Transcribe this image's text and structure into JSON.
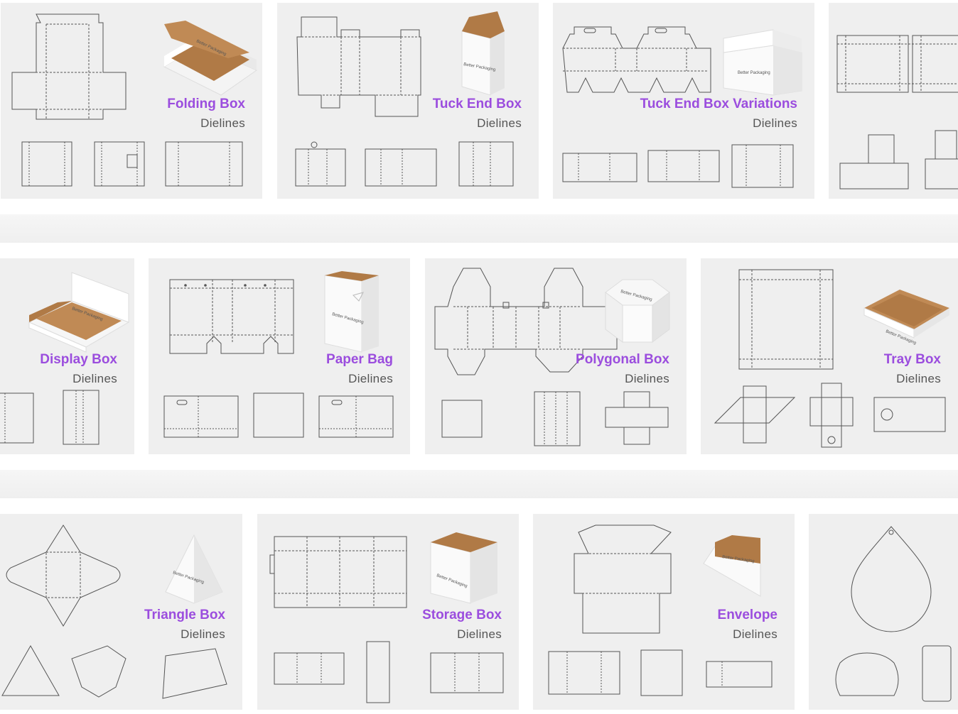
{
  "rows": [
    {
      "cards": [
        {
          "title": "Folding Box",
          "subtitle": "Dielines",
          "brand": "Better Packaging"
        },
        {
          "title": "Tuck End Box",
          "subtitle": "Dielines",
          "brand": "Better Packaging"
        },
        {
          "title": "Tuck End Box Variations",
          "subtitle": "Dielines",
          "brand": "Better Packaging"
        },
        {
          "title": "",
          "subtitle": "",
          "brand": ""
        }
      ]
    },
    {
      "cards": [
        {
          "title": "Display Box",
          "subtitle": "Dielines",
          "brand": "Better Packaging"
        },
        {
          "title": "Paper Bag",
          "subtitle": "Dielines",
          "brand": "Better Packaging"
        },
        {
          "title": "Polygonal Box",
          "subtitle": "Dielines",
          "brand": "Better Packaging"
        },
        {
          "title": "Tray Box",
          "subtitle": "Dielines",
          "brand": "Better Packaging"
        }
      ]
    },
    {
      "cards": [
        {
          "title": "Triangle Box",
          "subtitle": "Dielines",
          "brand": "Better Packaging"
        },
        {
          "title": "Storage Box",
          "subtitle": "Dielines",
          "brand": "Better Packaging"
        },
        {
          "title": "Envelope",
          "subtitle": "Dielines",
          "brand": "Better Packaging"
        },
        {
          "title": "",
          "subtitle": "",
          "brand": ""
        }
      ]
    }
  ],
  "colors": {
    "accent": "#9b4dde",
    "card_bg": "#efefef",
    "line": "#555555",
    "kraft": "#b07a46"
  }
}
